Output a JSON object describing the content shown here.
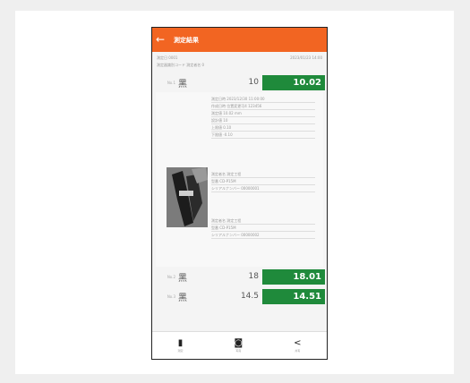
{
  "appbar": {
    "back": "←",
    "title": "測定結果"
  },
  "meta": {
    "left": "測定日 0001",
    "right": "2023/01/23 14:00",
    "sub": "測定器識別コード 測定者名 0"
  },
  "rows": [
    {
      "no": "No.1",
      "glyph": "黑",
      "plan": "10",
      "measured": "10.02"
    },
    {
      "no": "No.2",
      "glyph": "黑",
      "plan": "18",
      "measured": "18.01"
    },
    {
      "no": "No.3",
      "glyph": "黑",
      "plan": "14.5",
      "measured": "14.51"
    }
  ],
  "detail": {
    "group1": [
      "測定日時 2023/12/30 11:00:00",
      "作成日時 位置変更可4 123456",
      "測定値 10.02 mm",
      "設計値 10",
      "上限値 0.10",
      "下限値 -0.10"
    ],
    "group2": [
      "測定者名 測定工程",
      "型番 CD-P15M",
      "シリアルナンバー 00000001"
    ],
    "group3": [
      "測定者名 測定工程",
      "型番 CD-P15M",
      "シリアルナンバー 00000002"
    ]
  },
  "bottom": [
    {
      "icon": "device-icon",
      "glyph": "▮",
      "label": "測定"
    },
    {
      "icon": "camera-icon",
      "glyph": "◙",
      "label": "写真"
    },
    {
      "icon": "share-icon",
      "glyph": "<",
      "label": "共有"
    }
  ],
  "colors": {
    "accent": "#f26522",
    "ok_green": "#1f8a3b"
  }
}
